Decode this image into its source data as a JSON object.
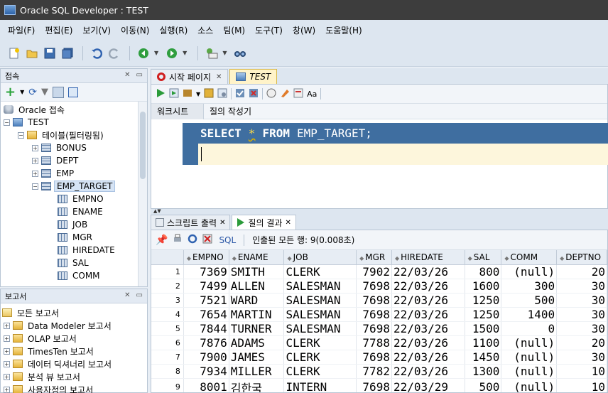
{
  "window": {
    "title": "Oracle SQL Developer : TEST"
  },
  "menu": [
    "파일(F)",
    "편집(E)",
    "보기(V)",
    "이동(N)",
    "실행(R)",
    "소스",
    "팀(M)",
    "도구(T)",
    "창(W)",
    "도움말(H)"
  ],
  "connections_panel": {
    "title": "접속",
    "tree": [
      {
        "label": "Oracle 접속",
        "level": 0,
        "icon": "database-icon",
        "expander": ""
      },
      {
        "label": "TEST",
        "level": 0,
        "icon": "connection-icon",
        "expander": "-"
      },
      {
        "label": "테이블(필터링됨)",
        "level": 1,
        "icon": "folder-icon",
        "expander": "-"
      },
      {
        "label": "BONUS",
        "level": 2,
        "icon": "table-icon",
        "expander": "+"
      },
      {
        "label": "DEPT",
        "level": 2,
        "icon": "table-icon",
        "expander": "+"
      },
      {
        "label": "EMP",
        "level": 2,
        "icon": "table-icon",
        "expander": "+"
      },
      {
        "label": "EMP_TARGET",
        "level": 2,
        "icon": "table-icon",
        "expander": "-",
        "selected": true
      },
      {
        "label": "EMPNO",
        "level": 3,
        "icon": "column-icon",
        "expander": ""
      },
      {
        "label": "ENAME",
        "level": 3,
        "icon": "column-icon",
        "expander": ""
      },
      {
        "label": "JOB",
        "level": 3,
        "icon": "column-icon",
        "expander": ""
      },
      {
        "label": "MGR",
        "level": 3,
        "icon": "column-icon",
        "expander": ""
      },
      {
        "label": "HIREDATE",
        "level": 3,
        "icon": "column-icon",
        "expander": ""
      },
      {
        "label": "SAL",
        "level": 3,
        "icon": "column-icon",
        "expander": ""
      },
      {
        "label": "COMM",
        "level": 3,
        "icon": "column-icon",
        "expander": ""
      }
    ]
  },
  "reports_panel": {
    "title": "보고서",
    "tree": [
      {
        "label": "모든 보고서",
        "level": 0,
        "expander": ""
      },
      {
        "label": "Data Modeler 보고서",
        "level": 1,
        "expander": "+"
      },
      {
        "label": "OLAP 보고서",
        "level": 1,
        "expander": "+"
      },
      {
        "label": "TimesTen 보고서",
        "level": 1,
        "expander": "+"
      },
      {
        "label": "데이터 딕셔너리 보고서",
        "level": 1,
        "expander": "+"
      },
      {
        "label": "분석 뷰 보고서",
        "level": 1,
        "expander": "+"
      },
      {
        "label": "사용자정의 보고서",
        "level": 1,
        "expander": "+"
      }
    ]
  },
  "editor_tabs": [
    {
      "label": "시작 페이지",
      "active": false
    },
    {
      "label": "TEST",
      "active": true
    }
  ],
  "editor": {
    "subtabs": [
      "워크시트",
      "질의 작성기"
    ],
    "sql": {
      "kw1": "SELECT",
      "star": "*",
      "kw2": "FROM",
      "table": "EMP_TARGET;"
    }
  },
  "result_tabs": [
    {
      "label": "스크립트 출력",
      "active": false
    },
    {
      "label": "질의 결과",
      "active": true
    }
  ],
  "results": {
    "sql_label": "SQL",
    "status": "인출된 모든 행: 9(0.008초)",
    "columns": [
      "EMPNO",
      "ENAME",
      "JOB",
      "MGR",
      "HIREDATE",
      "SAL",
      "COMM",
      "DEPTNO"
    ],
    "rows": [
      [
        "1",
        "7369",
        "SMITH",
        "CLERK",
        "7902",
        "22/03/26",
        "800",
        "(null)",
        "20"
      ],
      [
        "2",
        "7499",
        "ALLEN",
        "SALESMAN",
        "7698",
        "22/03/26",
        "1600",
        "300",
        "30"
      ],
      [
        "3",
        "7521",
        "WARD",
        "SALESMAN",
        "7698",
        "22/03/26",
        "1250",
        "500",
        "30"
      ],
      [
        "4",
        "7654",
        "MARTIN",
        "SALESMAN",
        "7698",
        "22/03/26",
        "1250",
        "1400",
        "30"
      ],
      [
        "5",
        "7844",
        "TURNER",
        "SALESMAN",
        "7698",
        "22/03/26",
        "1500",
        "0",
        "30"
      ],
      [
        "6",
        "7876",
        "ADAMS",
        "CLERK",
        "7788",
        "22/03/26",
        "1100",
        "(null)",
        "20"
      ],
      [
        "7",
        "7900",
        "JAMES",
        "CLERK",
        "7698",
        "22/03/26",
        "1450",
        "(null)",
        "30"
      ],
      [
        "8",
        "7934",
        "MILLER",
        "CLERK",
        "7782",
        "22/03/26",
        "1300",
        "(null)",
        "10"
      ],
      [
        "9",
        "8001",
        "김한국",
        "INTERN",
        "7698",
        "22/03/29",
        "500",
        "(null)",
        "10"
      ]
    ]
  }
}
